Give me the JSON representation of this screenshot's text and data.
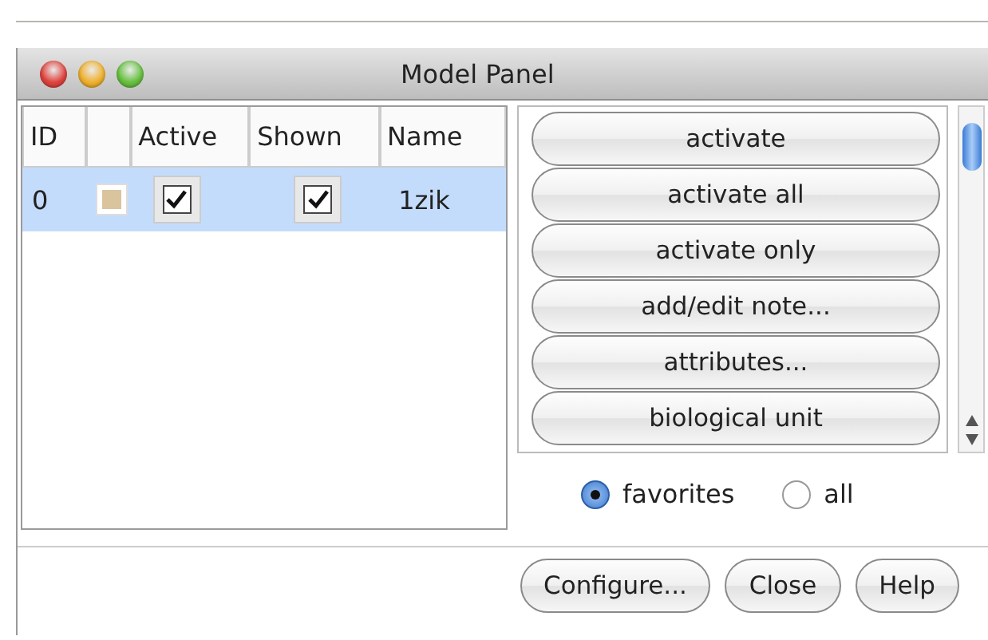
{
  "window": {
    "title": "Model Panel"
  },
  "table": {
    "columns": [
      "ID",
      "Active",
      "Shown",
      "Name"
    ],
    "rows": [
      {
        "id": "0",
        "color": "#d9c49e",
        "active": true,
        "shown": true,
        "name": "1zik",
        "selected": true
      }
    ]
  },
  "actions": [
    "activate",
    "activate all",
    "activate only",
    "add/edit note...",
    "attributes...",
    "biological unit"
  ],
  "filter": [
    {
      "label": "favorites",
      "selected": true
    },
    {
      "label": "all",
      "selected": false
    }
  ],
  "footer_buttons": [
    "Configure...",
    "Close",
    "Help"
  ]
}
